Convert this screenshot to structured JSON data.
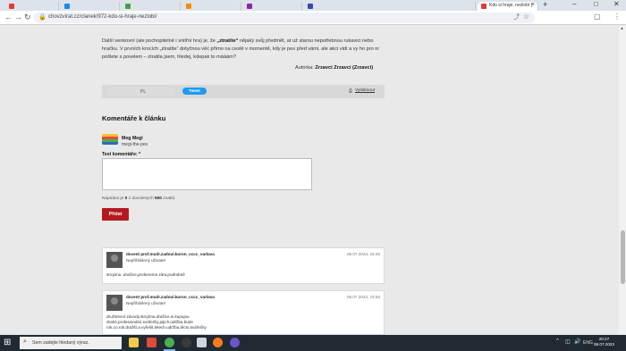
{
  "browser": {
    "tabs": [
      {
        "title": "",
        "color": "#e53935"
      },
      {
        "title": "",
        "color": "#1e88e5"
      },
      {
        "title": "",
        "color": "#43a047"
      },
      {
        "title": "",
        "color": "#fb8c00"
      },
      {
        "title": "",
        "color": "#8e24aa"
      },
      {
        "title": "",
        "color": "#3949ab"
      },
      {
        "title": "Kdo si hraje, nezlobí |",
        "color": "#e53935"
      }
    ],
    "new_tab": "+",
    "window_controls": [
      "–",
      "□",
      "✕"
    ],
    "url": "chovzvirat.cz/clanek/972-kdo-si-hraje-nezlobi/",
    "icons": {
      "back": "←",
      "forward": "→",
      "reload": "↻",
      "lock": "🔒",
      "share": "⤴",
      "star": "☆",
      "tabs": "▢",
      "menu": "⋮"
    }
  },
  "article": {
    "para_part1": "Další venkovní (ale pochopitelně i vnitřní hra) je, že ",
    "para_bold": "„ztratíte“",
    "para_part2": " nějaký svůj předmět, at už starou nepotřebnou rukavici nebo hračku. V prvních krocích „ztratíte“ dotyčnou věc přímo na cestě v momentě, kdy je pes před vámi, ale akci vidí a vy ho pro ni pošlete s povelem – ztratila jsem, hledej, kdepak to mááám?",
    "author_label": "Autorka: ",
    "author_name": "Zrzavci Zrzavci (Zrzavci)"
  },
  "share": {
    "like_count": "PL",
    "tweet_label": "Tweet",
    "print_icon": "⎙",
    "print_label": "Vytisknout"
  },
  "comments_section": {
    "heading": "Komentáře k článku",
    "user_name": "Meg Megi",
    "user_handle": "megi-the-pes",
    "field_label": "Text komentáře: *",
    "chars_prefix": "Napsáno je ",
    "chars_written": "0",
    "chars_middle": " z dovolených ",
    "chars_max": "500",
    "chars_suffix": " znaků.",
    "submit_label": "Přidat"
  },
  "comments": [
    {
      "author": "docent prof.mudr.zadoul.kuron_cccc_varlava",
      "role": "Nepřihlášený uživatel",
      "date": "06.07.2023, 16:45",
      "text": "strojirnu..dražice,probereme.zitra.podrobně"
    },
    {
      "author": "docent prof.mudr.zadoul.kuron_cccc_varlava",
      "role": "Nepřihlášený uživatel",
      "date": "06.07.2023, 15:50",
      "text": "družstevní.závody.strojírna.dražice.si.kupujou drahé.profesionální.svářečky.jejich.údržba.bude rok.co.rok.dražší.a.vyřešit.letech.udržba.těcto.svářečky"
    }
  ],
  "taskbar": {
    "start_icon": "⊞",
    "search_icon": "⌕",
    "search_placeholder": "Sem zadejte hledaný výraz.",
    "apps": [
      {
        "name": "taskview-icon",
        "color": "#2b2b2b"
      },
      {
        "name": "explorer-icon",
        "color": "#f2c94c"
      },
      {
        "name": "app-red-icon",
        "color": "#e04a3a"
      },
      {
        "name": "chrome-icon",
        "color": "#4caf50"
      },
      {
        "name": "app-dark-icon",
        "color": "#333"
      },
      {
        "name": "app-blue-icon",
        "color": "#2f6fb5"
      },
      {
        "name": "firefox-icon",
        "color": "#ff7a1a"
      },
      {
        "name": "vlc-icon",
        "color": "#f08a00"
      },
      {
        "name": "app-purple-icon",
        "color": "#6a55c9"
      }
    ],
    "tray_icons": [
      "^",
      "◫",
      "🔊",
      "ENG"
    ],
    "time": "20:27",
    "date": "06.07.2023"
  }
}
